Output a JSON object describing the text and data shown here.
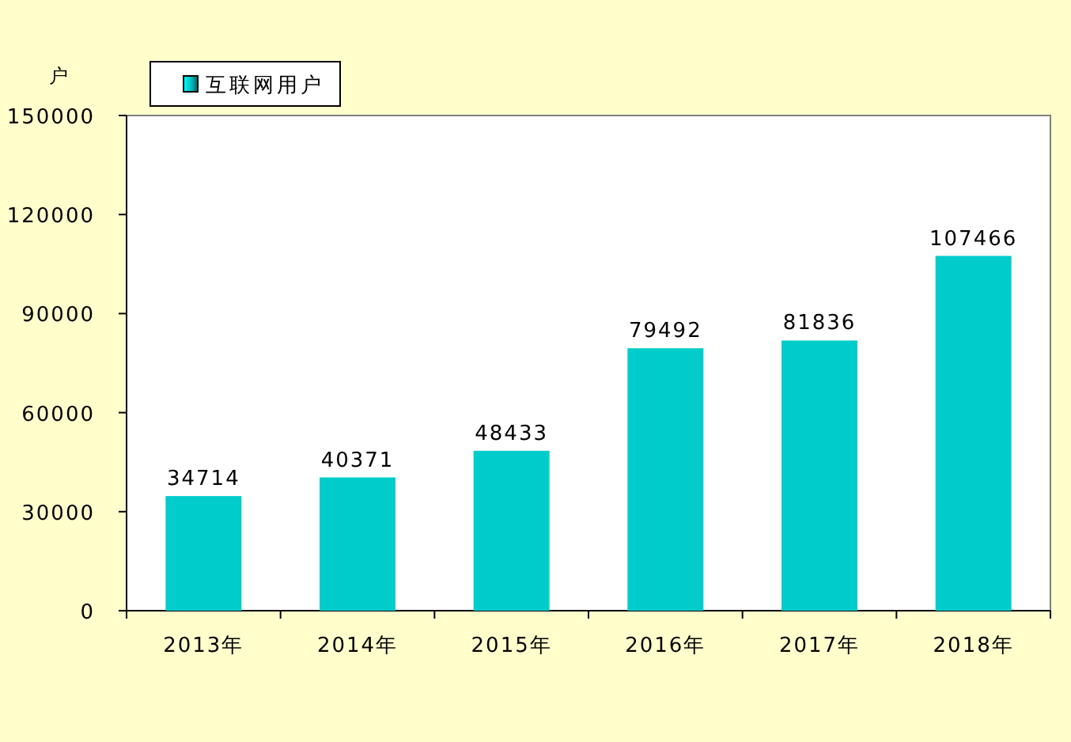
{
  "chart": {
    "chart_data": {
      "type": "bar",
      "ylabel": "户",
      "categories": [
        "2013年",
        "2014年",
        "2015年",
        "2016年",
        "2017年",
        "2018年"
      ],
      "series": [
        {
          "name": "互联网用户",
          "color": "#00cccc",
          "values": [
            34714,
            40371,
            48433,
            79492,
            81836,
            107466
          ]
        }
      ],
      "ylim": [
        0,
        150000
      ],
      "yticks": [
        0,
        30000,
        60000,
        90000,
        120000,
        150000
      ],
      "data_labels": true,
      "legend": true
    }
  }
}
